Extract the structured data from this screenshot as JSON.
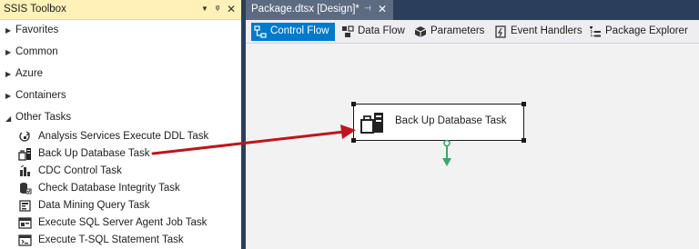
{
  "toolbox": {
    "title": "SSIS Toolbox",
    "categories": [
      {
        "label": "Favorites"
      },
      {
        "label": "Common"
      },
      {
        "label": "Azure"
      },
      {
        "label": "Containers"
      },
      {
        "label": "Other Tasks"
      }
    ],
    "items": [
      {
        "label": "Analysis Services Execute DDL Task",
        "icon": "analysis-services-icon"
      },
      {
        "label": "Back Up Database Task",
        "icon": "backup-database-icon"
      },
      {
        "label": "CDC Control Task",
        "icon": "cdc-control-icon"
      },
      {
        "label": "Check Database Integrity Task",
        "icon": "check-integrity-icon"
      },
      {
        "label": "Data Mining Query Task",
        "icon": "data-mining-icon"
      },
      {
        "label": "Execute SQL Server Agent Job Task",
        "icon": "agent-job-icon"
      },
      {
        "label": "Execute T-SQL Statement Task",
        "icon": "tsql-statement-icon"
      }
    ]
  },
  "document": {
    "tab_title": "Package.dtsx [Design]*",
    "designer_tabs": [
      {
        "label": "Control Flow",
        "active": true
      },
      {
        "label": "Data Flow",
        "active": false
      },
      {
        "label": "Parameters",
        "active": false
      },
      {
        "label": "Event Handlers",
        "active": false
      },
      {
        "label": "Package Explorer",
        "active": false
      }
    ]
  },
  "canvas": {
    "task_label": "Back Up Database Task"
  },
  "colors": {
    "toolbox_header": "#fff1b8",
    "doc_strip": "#2b3e5c",
    "active_tab": "#007acc",
    "arrow": "#c0151b",
    "connector": "#3aa86b"
  }
}
